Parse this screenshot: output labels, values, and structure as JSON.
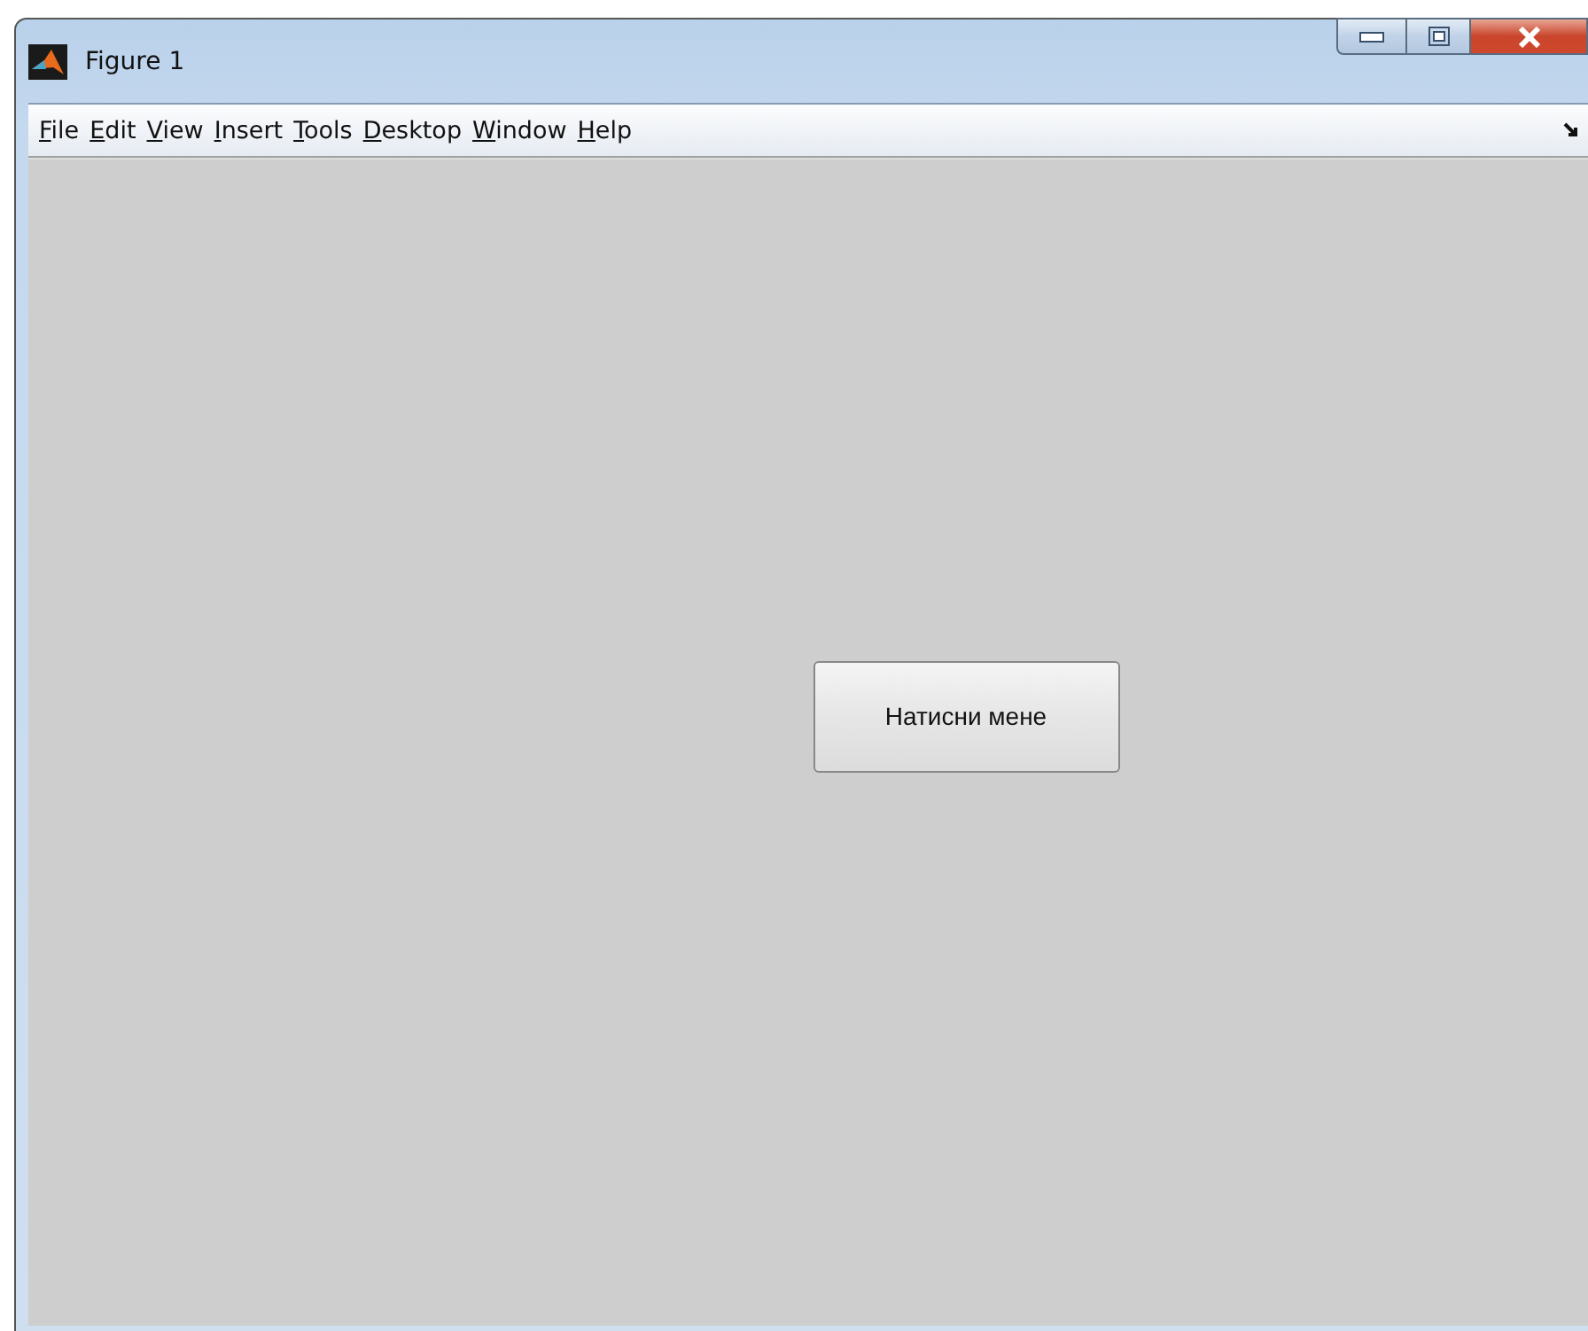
{
  "window": {
    "title": "Figure 1"
  },
  "menu": [
    {
      "label": "File"
    },
    {
      "label": "Edit"
    },
    {
      "label": "View"
    },
    {
      "label": "Insert"
    },
    {
      "label": "Tools"
    },
    {
      "label": "Desktop"
    },
    {
      "label": "Window"
    },
    {
      "label": "Help"
    }
  ],
  "button": {
    "label": "Натисни мене"
  }
}
